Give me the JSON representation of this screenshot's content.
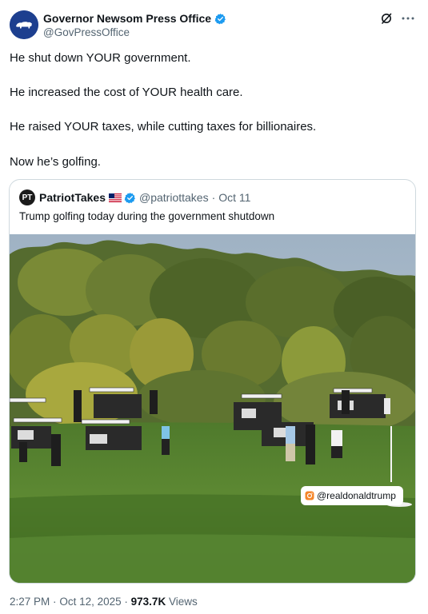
{
  "post": {
    "display_name": "Governor Newsom Press Office",
    "handle": "@GovPressOffice",
    "lines": [
      "He shut down YOUR government.",
      "He increased the cost of YOUR health care.",
      "He raised YOUR taxes, while cutting taxes for billionaires.",
      "Now he’s golfing."
    ],
    "time": "2:27 PM",
    "date": "Oct 12, 2025",
    "separator": "·",
    "views_count": "973.7K",
    "views_label": "Views"
  },
  "quoted": {
    "avatar_text": "PT",
    "display_name": "PatriotTakes",
    "handle": "@patriottakes",
    "separator": "·",
    "date": "Oct 11",
    "text": "Trump golfing today during the government shutdown",
    "image_tag": "@realdonaldtrump"
  },
  "icons": {
    "avatar": "bear-logo-icon",
    "verified": "verified-badge-icon",
    "grok": "grok-icon",
    "more": "more-icon",
    "flag": "us-flag-icon",
    "tag": "instagram-icon"
  },
  "colors": {
    "verified_blue": "#1d9bf0",
    "avatar_blue": "#1d3f8f",
    "text_primary": "#0f1419",
    "text_secondary": "#536471",
    "border": "#cfd9de"
  }
}
